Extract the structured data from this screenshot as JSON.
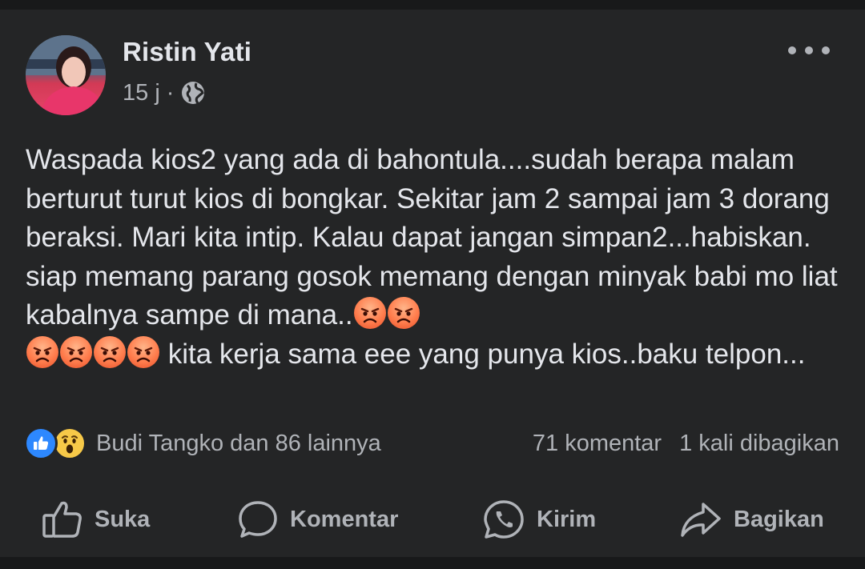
{
  "post": {
    "author": "Ristin Yati",
    "time": "15 j",
    "separator": "·",
    "audience_icon": "globe-icon",
    "text_segments": [
      "Waspada kios2 yang ada di bahontula....sudah berapa malam berturut turut kios di bongkar. Sekitar jam 2 sampai jam 3 dorang beraksi. Mari kita intip. Kalau dapat jangan simpan2...habiskan. siap memang parang gosok memang dengan minyak babi mo liat kabalnya sampe di mana..",
      " kita kerja sama eee yang punya kios..baku telpon..."
    ],
    "emoji_icon": "angry-face-emoji"
  },
  "reactions": {
    "icons": [
      "like-icon",
      "wow-icon"
    ],
    "names": "Budi Tangko dan 86 lainnya",
    "comments": "71 komentar",
    "shares": "1 kali dibagikan"
  },
  "actions": {
    "like": "Suka",
    "comment": "Komentar",
    "send": "Kirim",
    "share": "Bagikan"
  },
  "colors": {
    "background": "#18191a",
    "card": "#242526",
    "text_primary": "#e4e6eb",
    "text_secondary": "#b0b3b8",
    "like_blue": "#2d88ff"
  }
}
